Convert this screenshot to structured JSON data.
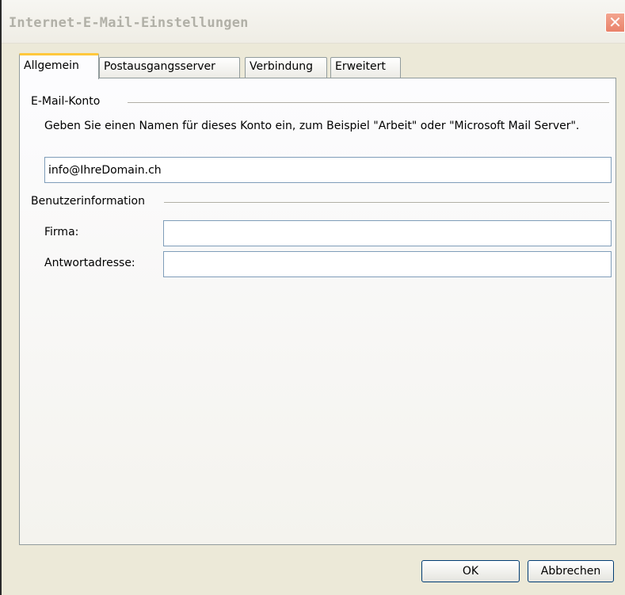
{
  "window": {
    "title": "Internet-E-Mail-Einstellungen",
    "close_glyph": "✕"
  },
  "tabs": [
    {
      "label": "Allgemein",
      "active": true
    },
    {
      "label": "Postausgangsserver",
      "active": false
    },
    {
      "label": "Verbindung",
      "active": false
    },
    {
      "label": "Erweitert",
      "active": false
    }
  ],
  "email_account": {
    "group_label": "E-Mail-Konto",
    "description": "Geben Sie einen Namen für dieses Konto ein, zum Beispiel \"Arbeit\" oder \"Microsoft Mail Server\".",
    "account_name_value": "info@IhreDomain.ch"
  },
  "user_info": {
    "group_label": "Benutzerinformation",
    "company_label": "Firma:",
    "company_value": "",
    "reply_label": "Antwortadresse:",
    "reply_value": ""
  },
  "buttons": {
    "ok_label": "OK",
    "cancel_label": "Abbrechen"
  },
  "colors": {
    "window_background": "#ece9d8",
    "active_tab_accent": "#ffc83c",
    "close_button": "#e9826a",
    "button_border": "#003c74"
  }
}
